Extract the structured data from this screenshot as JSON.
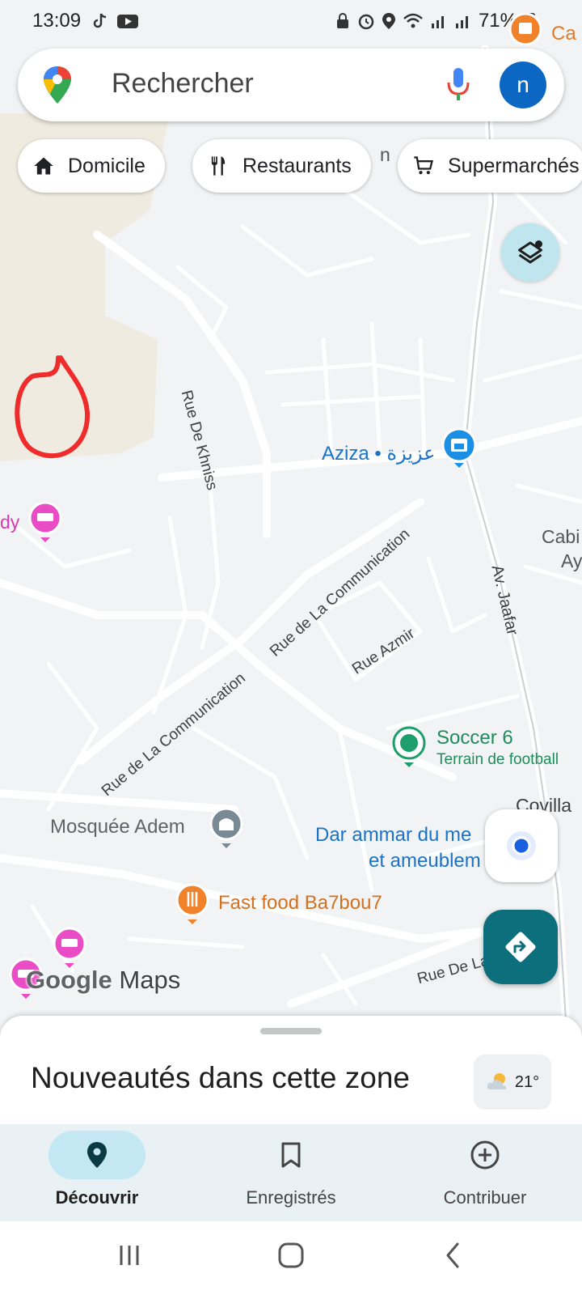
{
  "status_bar": {
    "time": "13:09",
    "battery": "71%",
    "left_icons": [
      "tiktok-icon",
      "youtube-icon"
    ],
    "right_icons": [
      "lock-icon",
      "alarm-icon",
      "location-icon",
      "wifi-icon",
      "signal-icon",
      "signal-icon",
      "battery-icon"
    ]
  },
  "search": {
    "placeholder": "Rechercher",
    "avatar_letter": "n"
  },
  "chips": [
    {
      "label": "Domicile",
      "icon": "home-icon"
    },
    {
      "label": "Restaurants",
      "icon": "restaurant-icon"
    },
    {
      "label": "Supermarchés",
      "icon": "cart-icon"
    }
  ],
  "map_labels": {
    "rue_khniss": "Rue De Khniss",
    "aziza": "Aziza • عزيزة",
    "rue_communication_1": "Rue de La Communication",
    "rue_communication_2": "Rue de La Communication",
    "rue_azmir": "Rue Azmir",
    "av_jaafar": "Av. Jaafar",
    "soccer": "Soccer 6",
    "soccer_sub": "Terrain de football",
    "mosquee": "Mosquée Adem",
    "dar_ammar_1": "Dar ammar du me",
    "dar_ammar_2": "et ameublem",
    "fast_food": "Fast food Ba7bou7",
    "covilla": "Covilla",
    "cabi_1": "Cabi",
    "cabi_2": "Ay",
    "rue_de_la": "Rue De La",
    "dy": "dy",
    "ca": "Ca",
    "n_partial": "n"
  },
  "attribution": {
    "google": "Google",
    "maps": "Maps"
  },
  "bottom_sheet": {
    "title": "Nouveautés dans cette zone",
    "temperature": "21°"
  },
  "bottom_nav": [
    {
      "label": "Découvrir",
      "icon": "explore-pin-icon",
      "active": true
    },
    {
      "label": "Enregistrés",
      "icon": "bookmark-icon",
      "active": false
    },
    {
      "label": "Contribuer",
      "icon": "add-circle-icon",
      "active": false
    }
  ],
  "colors": {
    "accent": "#0e6f7c",
    "hotel_pin": "#e94cc4",
    "food_pin": "#f0822c",
    "shop_pin": "#1a8fe3",
    "sport_pin": "#1e9e6a",
    "annotation": "#ef2b2b"
  }
}
